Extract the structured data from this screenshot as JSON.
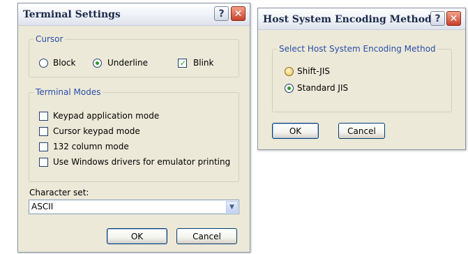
{
  "terminal_settings": {
    "title": "Terminal Settings",
    "help_glyph": "?",
    "close_glyph": "✕",
    "cursor": {
      "legend": "Cursor",
      "options": [
        {
          "label": "Block",
          "selected": false
        },
        {
          "label": "Underline",
          "selected": true
        }
      ],
      "blink": {
        "label": "Blink",
        "checked": true
      }
    },
    "terminal_modes": {
      "legend": "Terminal Modes",
      "options": [
        {
          "label": "Keypad application mode",
          "checked": false
        },
        {
          "label": "Cursor keypad mode",
          "checked": false
        },
        {
          "label": "132 column mode",
          "checked": false
        },
        {
          "label": "Use Windows drivers for emulator printing",
          "checked": false
        }
      ]
    },
    "character_set": {
      "label": "Character set:",
      "value": "ASCII"
    },
    "ok_label": "OK",
    "cancel_label": "Cancel"
  },
  "host_encoding": {
    "title": "Host System Encoding Method",
    "help_glyph": "?",
    "close_glyph": "✕",
    "group_legend": "Select Host System Encoding Method",
    "options": [
      {
        "label": "Shift-JIS",
        "selected": false
      },
      {
        "label": "Standard JIS",
        "selected": true
      }
    ],
    "ok_label": "OK",
    "cancel_label": "Cancel"
  },
  "icons": [
    "help-icon",
    "close-icon",
    "chevron-down-icon",
    "checkmark-icon"
  ]
}
